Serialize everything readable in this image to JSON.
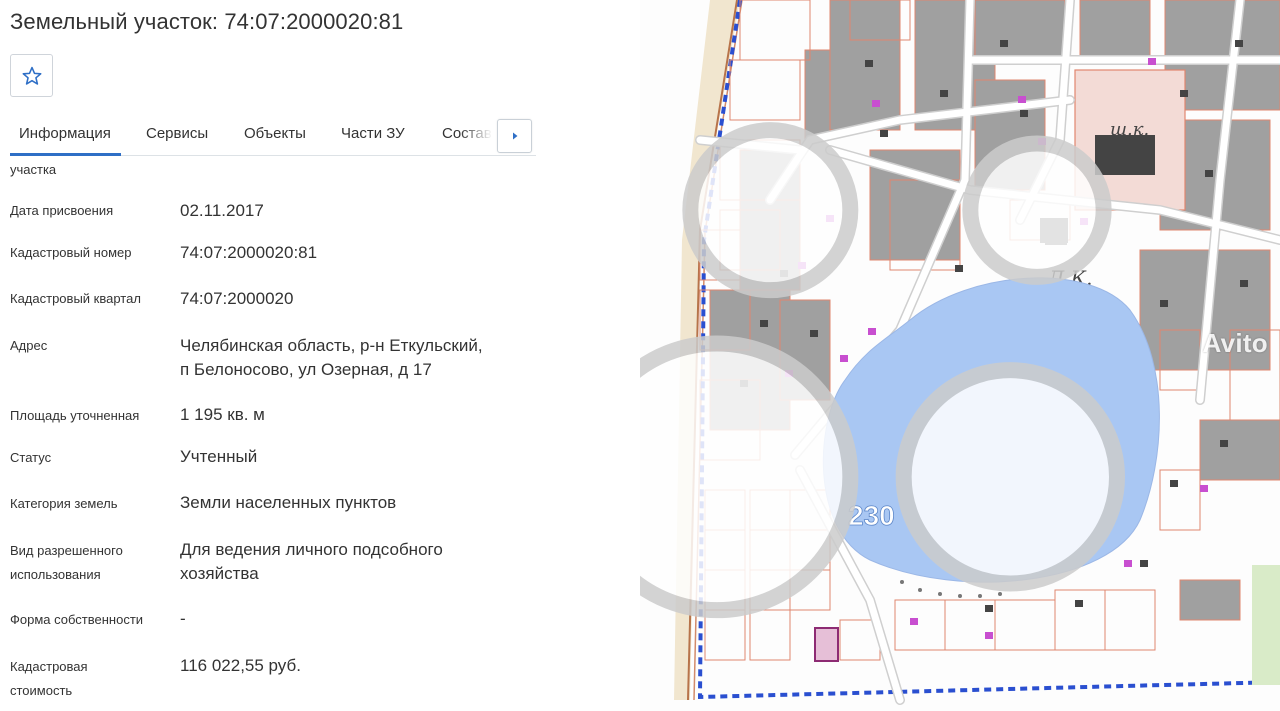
{
  "title": "Земельный участок: 74:07:2000020:81",
  "favorite": {
    "icon": "star-outline-icon"
  },
  "tabs": [
    {
      "label": "Информация",
      "active": true
    },
    {
      "label": "Сервисы"
    },
    {
      "label": "Объекты"
    },
    {
      "label": "Части ЗУ"
    },
    {
      "label": "Состав"
    }
  ],
  "tab_next_icon": "caret-right-icon",
  "fields": {
    "truncated_label": "участка",
    "date_assigned": {
      "label": "Дата присвоения",
      "value": "02.11.2017"
    },
    "cadastral_number": {
      "label": "Кадастровый номер",
      "value": "74:07:2000020:81"
    },
    "cadastral_quarter": {
      "label": "Кадастровый квартал",
      "value": "74:07:2000020"
    },
    "address": {
      "label": "Адрес",
      "line1": "Челябинская область, р-н Еткульский,",
      "line2": "п Белоносово, ул Озерная, д 17"
    },
    "area": {
      "label": "Площадь уточненная",
      "value": "1 195 кв. м"
    },
    "status": {
      "label": "Статус",
      "value": "Учтенный"
    },
    "land_category": {
      "label": "Категория земель",
      "value": "Земли населенных пунктов"
    },
    "permitted_use": {
      "label1": "Вид разрешенного",
      "label2": "использования",
      "line1": "Для ведения личного подсобного",
      "line2": "хозяйства"
    },
    "ownership": {
      "label": "Форма собственности",
      "value": "-"
    },
    "cadastral_value": {
      "label1": "Кадастровая",
      "label2": "стоимость",
      "value": "116 022,55 руб."
    }
  },
  "map": {
    "labels": {
      "school": "ш.к.",
      "culture_house": "Д.К.",
      "lake_elevation": "230"
    },
    "colors": {
      "lake": "#a9c7f3",
      "parcel_outline": "#e0866f",
      "building": "#9a9a9a",
      "boundary": "#2a4fd0",
      "highlight": "#c03a9c"
    }
  },
  "watermark": "Avito"
}
